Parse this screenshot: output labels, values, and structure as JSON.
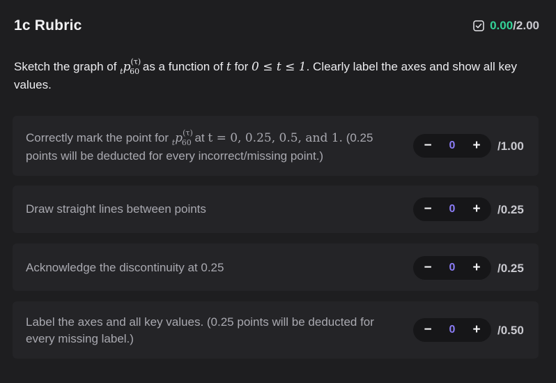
{
  "rubric": {
    "title": "1c Rubric",
    "score": {
      "current": "0.00",
      "total": "/2.00",
      "icon": "check-square-icon",
      "current_color": "#34d399"
    }
  },
  "question": {
    "prefix": "Sketch the graph of ",
    "math_symbol": {
      "pre_sub": "t",
      "base": "p",
      "sub": "60",
      "sup": "(τ)"
    },
    "middle": " as a function of ",
    "var_t": "t",
    "for_text": " for ",
    "range": "0 ≤ t ≤ 1",
    "suffix": ". Clearly label the axes and show all key values."
  },
  "items": [
    {
      "text_a": "Correctly mark the point for ",
      "math_symbol": {
        "pre_sub": "t",
        "base": "p",
        "sub": "60",
        "sup": "(τ)"
      },
      "text_b": " at ",
      "math_eq": "t = 0, 0.25, 0.5, and 1.",
      "text_c": " (0.25 points will be deducted for every incorrect/missing point.)",
      "value": "0",
      "max": "/1.00"
    },
    {
      "text": "Draw straight lines between points",
      "value": "0",
      "max": "/0.25"
    },
    {
      "text": "Acknowledge the discontinuity at 0.25",
      "value": "0",
      "max": "/0.25"
    },
    {
      "text": "Label the axes and all key values. (0.25 points will be deducted for every missing label.)",
      "value": "0",
      "max": "/0.50"
    }
  ],
  "stepper": {
    "minus": "−",
    "plus": "+"
  },
  "colors": {
    "background": "#1e1e20",
    "card": "#242427",
    "stepper_value": "#8b7cf6"
  }
}
